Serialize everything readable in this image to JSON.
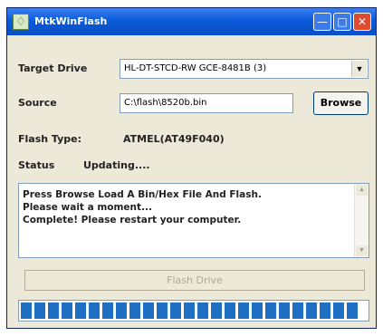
{
  "window": {
    "title": "MtkWinFlash",
    "icon": "app-flash-icon"
  },
  "fields": {
    "target_drive_label": "Target Drive",
    "target_drive_value": "HL-DT-STCD-RW GCE-8481B (3)",
    "source_label": "Source",
    "source_value": "C:\\flash\\8520b.bin",
    "browse_label": "Browse",
    "flash_type_label": "Flash Type:",
    "flash_type_value": "ATMEL(AT49F040)",
    "status_label": "Status",
    "status_value": "Updating...."
  },
  "log": {
    "lines": [
      "Press Browse Load A Bin/Hex File And Flash.",
      "Please wait a moment...",
      "Complete! Please restart your computer."
    ]
  },
  "actions": {
    "flash_label": "Flash Drive"
  },
  "progress": {
    "fraction": 1.0,
    "color": "#1f6fc4"
  },
  "colors": {
    "titlebar": "#0b5bd9",
    "face": "#ece9d8",
    "close": "#e04a2e"
  }
}
